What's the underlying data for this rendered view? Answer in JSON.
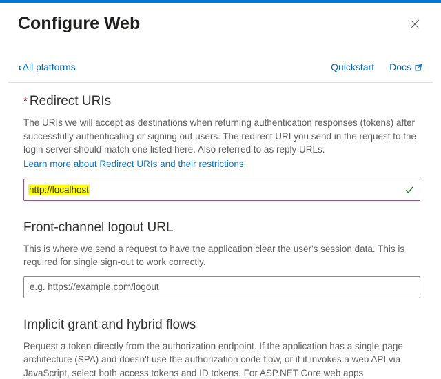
{
  "header": {
    "title": "Configure Web",
    "backLabel": "All platforms",
    "quickstart": "Quickstart",
    "docs": "Docs"
  },
  "sections": {
    "redirect": {
      "title": "Redirect URIs",
      "required": true,
      "description": "The URIs we will accept as destinations when returning authentication responses (tokens) after successfully authenticating or signing out users. The redirect URI you send in the request to the login server should match one listed here. Also referred to as reply URLs.",
      "learnMore": "Learn more about Redirect URIs and their restrictions",
      "value": "http://localhost"
    },
    "logout": {
      "title": "Front-channel logout URL",
      "description": "This is where we send a request to have the application clear the user's session data. This is required for single sign-out to work correctly.",
      "placeholder": "e.g. https://example.com/logout",
      "value": ""
    },
    "implicit": {
      "title": "Implicit grant and hybrid flows",
      "description": "Request a token directly from the authorization endpoint. If the application has a single-page architecture (SPA) and doesn't use the authorization code flow, or if it invokes a web API via JavaScript, select both access tokens and ID tokens. For ASP.NET Core web apps"
    }
  }
}
